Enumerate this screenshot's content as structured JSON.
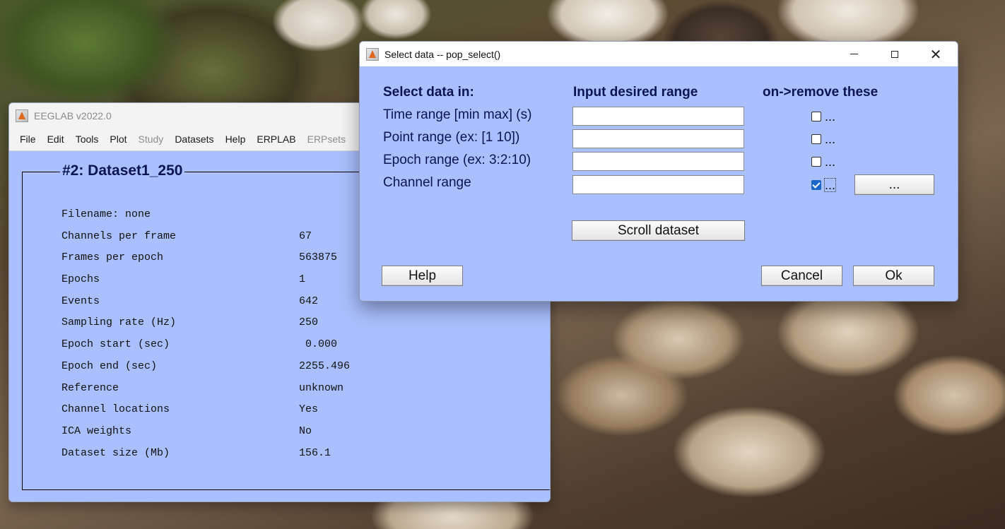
{
  "eeglab": {
    "title": "EEGLAB v2022.0",
    "menu": [
      {
        "label": "File",
        "enabled": true
      },
      {
        "label": "Edit",
        "enabled": true
      },
      {
        "label": "Tools",
        "enabled": true
      },
      {
        "label": "Plot",
        "enabled": true
      },
      {
        "label": "Study",
        "enabled": false
      },
      {
        "label": "Datasets",
        "enabled": true
      },
      {
        "label": "Help",
        "enabled": true
      },
      {
        "label": "ERPLAB",
        "enabled": true
      },
      {
        "label": "ERPsets",
        "enabled": false
      }
    ],
    "dataset_heading": "#2: Dataset1_250",
    "filename_line": "Filename: none",
    "info": [
      {
        "label": "Channels per frame",
        "value": "67"
      },
      {
        "label": "Frames per epoch",
        "value": "563875"
      },
      {
        "label": "Epochs",
        "value": "1"
      },
      {
        "label": "Events",
        "value": "642"
      },
      {
        "label": "Sampling rate (Hz)",
        "value": "250"
      },
      {
        "label": "Epoch start (sec)",
        "value": " 0.000"
      },
      {
        "label": "Epoch end (sec)",
        "value": "2255.496"
      },
      {
        "label": "Reference",
        "value": "unknown"
      },
      {
        "label": "Channel locations",
        "value": "Yes"
      },
      {
        "label": "ICA weights",
        "value": "No"
      },
      {
        "label": "Dataset size (Mb)",
        "value": "156.1"
      }
    ]
  },
  "dialog": {
    "title": "Select data -- pop_select()",
    "col_select": "Select data in:",
    "col_range": "Input desired range",
    "col_remove": "on->remove these",
    "rows": [
      {
        "label": "Time range [min max] (s)",
        "value": "",
        "remove": false,
        "dots": "..."
      },
      {
        "label": "Point range (ex: [1 10])",
        "value": "",
        "remove": false,
        "dots": "..."
      },
      {
        "label": "Epoch range (ex: 3:2:10)",
        "value": "",
        "remove": false,
        "dots": "..."
      },
      {
        "label": "Channel range",
        "value": "",
        "remove": true,
        "dots": "..."
      }
    ],
    "channel_browse_label": "...",
    "scroll_label": "Scroll dataset",
    "help_label": "Help",
    "cancel_label": "Cancel",
    "ok_label": "Ok"
  }
}
